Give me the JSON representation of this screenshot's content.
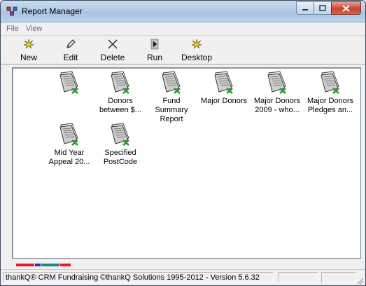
{
  "window": {
    "title": "Report Manager"
  },
  "menu": {
    "items": [
      "File",
      "View"
    ]
  },
  "toolbar": {
    "buttons": [
      {
        "label": "New",
        "icon": "star-burst-icon"
      },
      {
        "label": "Edit",
        "icon": "pencil-icon"
      },
      {
        "label": "Delete",
        "icon": "delete-x-icon"
      },
      {
        "label": "Run",
        "icon": "run-arrow-icon"
      },
      {
        "label": "Desktop",
        "icon": "star-burst-icon"
      }
    ]
  },
  "reports": [
    {
      "label": ""
    },
    {
      "label": "Donors\nbetween $..."
    },
    {
      "label": "Fund Summary\nReport"
    },
    {
      "label": "Major Donors"
    },
    {
      "label": "Major Donors\n2009 - who..."
    },
    {
      "label": "Major Donors\nPledges an..."
    },
    {
      "label": "Mid Year\nAppeal 20..."
    },
    {
      "label": "Specified\nPostCode"
    }
  ],
  "status": {
    "copyright": "thankQ® CRM Fundraising ©thankQ Solutions 1995-2012 - Version 5.6.32"
  },
  "colors": {
    "strip": [
      "#e51c23",
      "#1a3fb8",
      "#1a8a8a",
      "#e51c23"
    ],
    "report_icon_check": "#2a9d2a"
  }
}
